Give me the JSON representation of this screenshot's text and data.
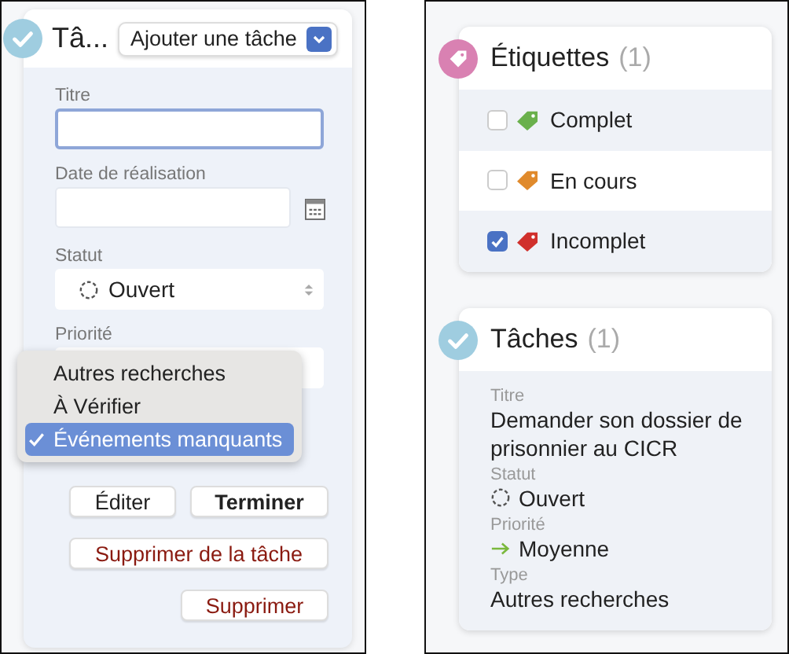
{
  "task_form": {
    "title": "Tâ...",
    "add_button": "Ajouter une tâche",
    "fields": [
      {
        "kind": "text",
        "label": "Titre",
        "focused": true
      },
      {
        "kind": "date",
        "label": "Date de réalisation"
      },
      {
        "kind": "status",
        "label": "Statut",
        "value": "Ouvert"
      },
      {
        "kind": "hidden",
        "label": "Priorité"
      }
    ],
    "dropdown": [
      {
        "label": "Autres recherches",
        "selected": false
      },
      {
        "label": "À Vérifier",
        "selected": false
      },
      {
        "label": "Événements manquants",
        "selected": true
      }
    ],
    "buttons": [
      {
        "label": "Éditer",
        "kind": "plain"
      },
      {
        "label": "Terminer",
        "kind": "bold"
      },
      {
        "label": "Supprimer de la tâche",
        "kind": "danger-wide"
      },
      {
        "label": "Supprimer",
        "kind": "danger"
      }
    ]
  },
  "tags_card": {
    "title": "Étiquettes",
    "count": "(1)",
    "tags": [
      {
        "label": "Complet",
        "checked": false,
        "color": "#6ab04c"
      },
      {
        "label": "En cours",
        "checked": false,
        "color": "#e08a2c"
      },
      {
        "label": "Incomplet",
        "checked": true,
        "color": "#d0302c"
      }
    ]
  },
  "tasks_card": {
    "title": "Tâches",
    "count": "(1)",
    "details": [
      {
        "label": "Titre",
        "value": "Demander son dossier de prisonnier au CICR",
        "kind": "text"
      },
      {
        "label": "Statut",
        "value": "Ouvert",
        "kind": "status"
      },
      {
        "label": "Priorité",
        "value": "Moyenne",
        "kind": "arrow"
      },
      {
        "label": "Type",
        "value": "Autres recherches",
        "kind": "text"
      }
    ]
  }
}
